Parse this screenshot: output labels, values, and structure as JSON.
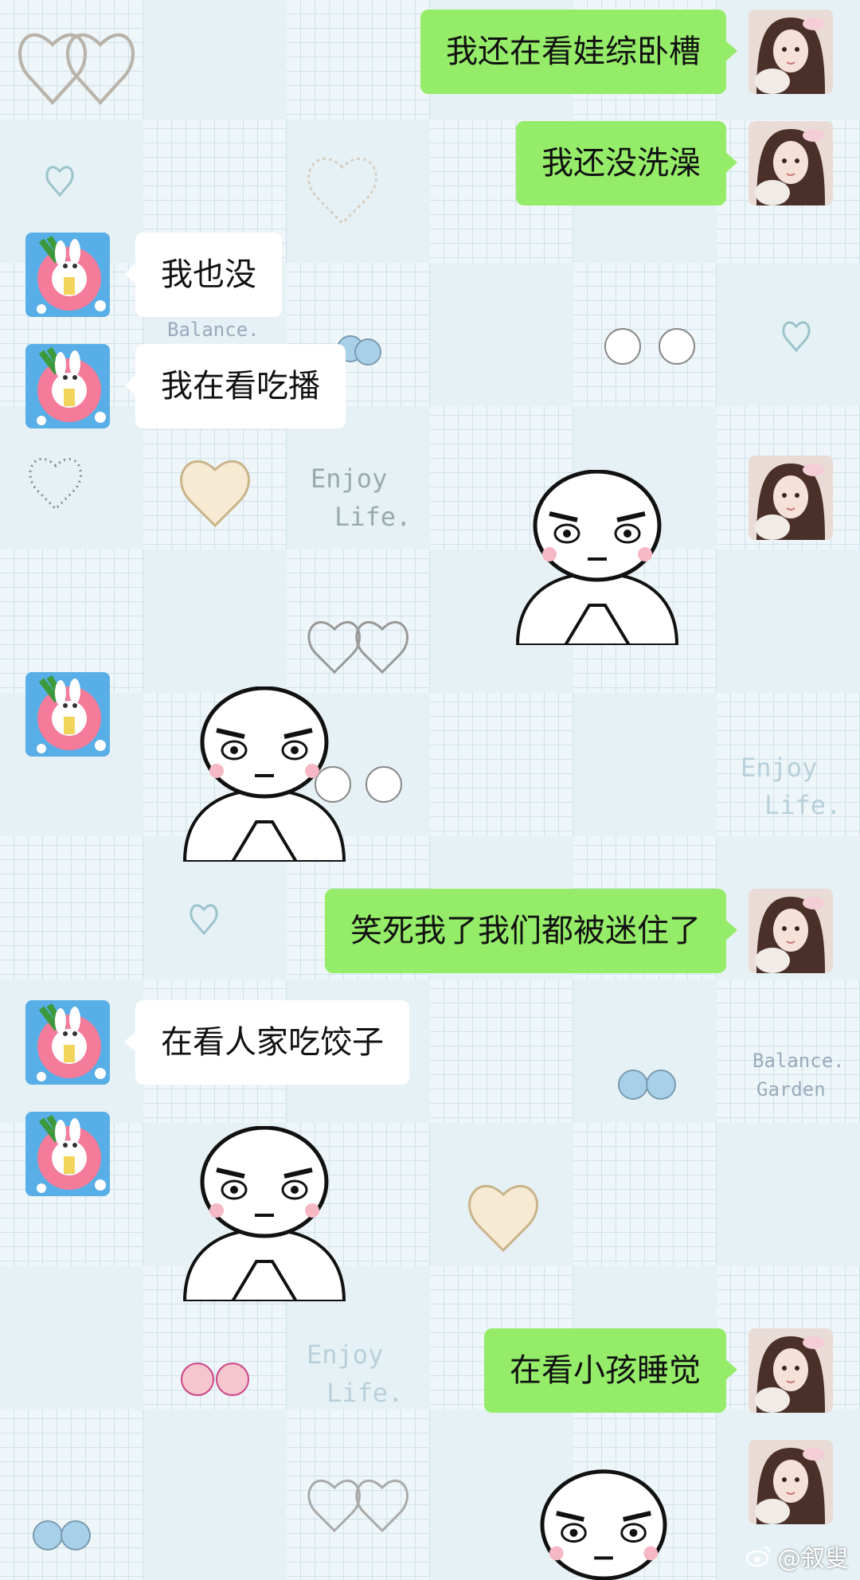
{
  "messages": [
    {
      "side": "me",
      "text": "我还在看娃综卧槽"
    },
    {
      "side": "me",
      "text": "我还没洗澡"
    },
    {
      "side": "them",
      "text": "我也没"
    },
    {
      "side": "them",
      "text": "我在看吃播"
    },
    {
      "side": "me",
      "type": "sticker"
    },
    {
      "side": "them",
      "type": "sticker"
    },
    {
      "side": "me",
      "text": "笑死我了我们都被迷住了"
    },
    {
      "side": "them",
      "text": "在看人家吃饺子"
    },
    {
      "side": "them",
      "type": "sticker"
    },
    {
      "side": "me",
      "text": "在看小孩睡觉"
    },
    {
      "side": "me",
      "type": "sticker"
    }
  ],
  "background_text": {
    "enjoy": "Enjoy",
    "life": "Life.",
    "balance": "Balance.",
    "garden": "Garden"
  },
  "watermark": {
    "text": "@叙叟",
    "icon": "weibo-icon"
  },
  "colors": {
    "me_bubble": "#95ec69",
    "them_bubble": "#ffffff",
    "background": "#e9f3f6"
  }
}
